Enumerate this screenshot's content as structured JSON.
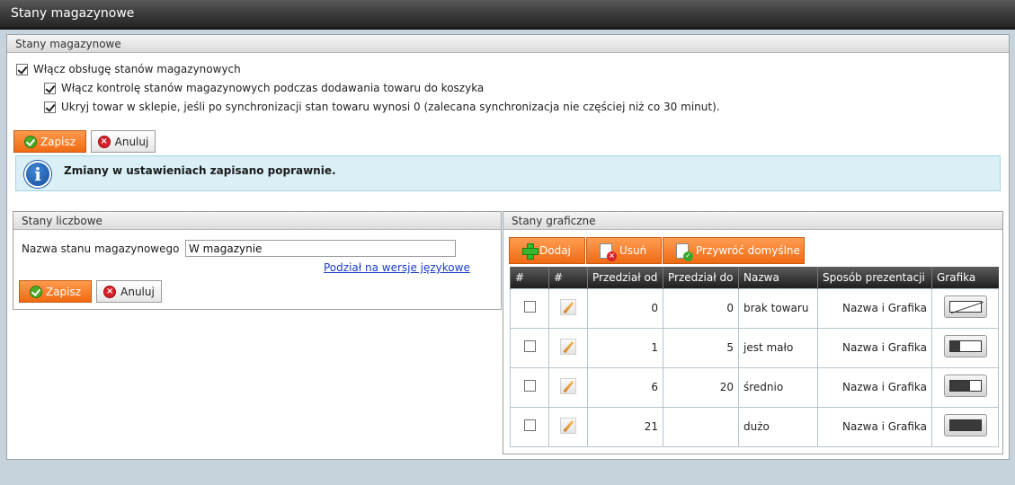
{
  "window": {
    "title": "Stany magazynowe"
  },
  "settings": {
    "panel_title": "Stany magazynowe",
    "opt_enable": {
      "label": "Włącz obsługę stanów magazynowych",
      "checked": true
    },
    "opt_control": {
      "label": "Włącz kontrolę stanów magazynowych podczas dodawania towaru do koszyka",
      "checked": true
    },
    "opt_hide": {
      "label": "Ukryj towar w sklepie, jeśli po synchronizacji stan towaru wynosi 0 (zalecana synchronizacja nie częściej niż co 30 minut).",
      "checked": true
    },
    "save_label": "Zapisz",
    "cancel_label": "Anuluj",
    "info_message": "Zmiany w ustawieniach zapisano poprawnie."
  },
  "numeric": {
    "panel_title": "Stany liczbowe",
    "name_label": "Nazwa stanu magazynowego",
    "name_value": "W magazynie",
    "lang_link": "Podział na wersje językowe",
    "save_label": "Zapisz",
    "cancel_label": "Anuluj"
  },
  "graphic": {
    "panel_title": "Stany graficzne",
    "add_label": "Dodaj",
    "remove_label": "Usuń",
    "restore_label": "Przywróć domyślne",
    "columns": [
      "#",
      "#",
      "Przedział od",
      "Przedział do",
      "Nazwa",
      "Sposób prezentacji",
      "Grafika"
    ],
    "rows": [
      {
        "from": "0",
        "to": "0",
        "name": "brak towaru",
        "presentation": "Nazwa i Grafika",
        "level": 0,
        "icon": "empty-stock-gauge-icon"
      },
      {
        "from": "1",
        "to": "5",
        "name": "jest mało",
        "presentation": "Nazwa i Grafika",
        "level": 0.33,
        "icon": "low-stock-gauge-icon"
      },
      {
        "from": "6",
        "to": "20",
        "name": "średnio",
        "presentation": "Nazwa i Grafika",
        "level": 0.66,
        "icon": "medium-stock-gauge-icon"
      },
      {
        "from": "21",
        "to": "",
        "name": "dużo",
        "presentation": "Nazwa i Grafika",
        "level": 1,
        "icon": "high-stock-gauge-icon"
      }
    ]
  },
  "colors": {
    "accent": "#f06a12",
    "info_bg": "#daf0f6",
    "titlebar": "#2e2e2e"
  }
}
